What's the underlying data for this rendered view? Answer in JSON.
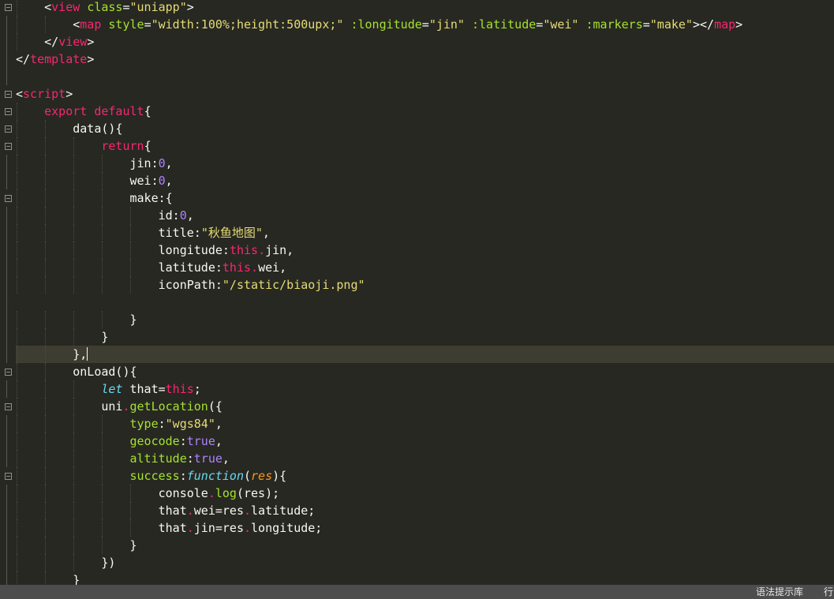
{
  "editor": {
    "lines": [
      {
        "indent": "    ",
        "tokens": [
          [
            "t-punc",
            "<"
          ],
          [
            "t-tag",
            "view"
          ],
          [
            "t-punc",
            " "
          ],
          [
            "t-attr",
            "class"
          ],
          [
            "t-punc",
            "="
          ],
          [
            "t-str",
            "\"uniapp\""
          ],
          [
            "t-punc",
            ">"
          ]
        ]
      },
      {
        "indent": "        ",
        "tokens": [
          [
            "t-punc",
            "<"
          ],
          [
            "t-tag",
            "map"
          ],
          [
            "t-punc",
            " "
          ],
          [
            "t-attr",
            "style"
          ],
          [
            "t-punc",
            "="
          ],
          [
            "t-str",
            "\"width:100%;height:500upx;\""
          ],
          [
            "t-punc",
            " "
          ],
          [
            "t-attr",
            ":longitude"
          ],
          [
            "t-punc",
            "="
          ],
          [
            "t-str",
            "\"jin\""
          ],
          [
            "t-punc",
            " "
          ],
          [
            "t-attr",
            ":latitude"
          ],
          [
            "t-punc",
            "="
          ],
          [
            "t-str",
            "\"wei\""
          ],
          [
            "t-punc",
            " "
          ],
          [
            "t-attr",
            ":markers"
          ],
          [
            "t-punc",
            "="
          ],
          [
            "t-str",
            "\"make\""
          ],
          [
            "t-punc",
            ">"
          ],
          [
            "t-punc",
            "</"
          ],
          [
            "t-tag",
            "map"
          ],
          [
            "t-punc",
            ">"
          ]
        ]
      },
      {
        "indent": "    ",
        "tokens": [
          [
            "t-punc",
            "</"
          ],
          [
            "t-tag",
            "view"
          ],
          [
            "t-punc",
            ">"
          ]
        ]
      },
      {
        "indent": "",
        "tokens": [
          [
            "t-punc",
            "</"
          ],
          [
            "t-tag",
            "template"
          ],
          [
            "t-punc",
            ">"
          ]
        ]
      },
      {
        "indent": "",
        "tokens": []
      },
      {
        "indent": "",
        "tokens": [
          [
            "t-punc",
            "<"
          ],
          [
            "t-tag",
            "script"
          ],
          [
            "t-punc",
            ">"
          ]
        ]
      },
      {
        "indent": "    ",
        "tokens": [
          [
            "t-kw",
            "export"
          ],
          [
            "t-punc",
            " "
          ],
          [
            "t-kw",
            "default"
          ],
          [
            "t-punc",
            "{"
          ]
        ]
      },
      {
        "indent": "        ",
        "tokens": [
          [
            "t-punc",
            "data(){"
          ]
        ]
      },
      {
        "indent": "            ",
        "tokens": [
          [
            "t-kw",
            "return"
          ],
          [
            "t-punc",
            "{"
          ]
        ]
      },
      {
        "indent": "                ",
        "tokens": [
          [
            "t-punc",
            "jin:"
          ],
          [
            "t-num",
            "0"
          ],
          [
            "t-punc",
            ","
          ]
        ]
      },
      {
        "indent": "                ",
        "tokens": [
          [
            "t-punc",
            "wei:"
          ],
          [
            "t-num",
            "0"
          ],
          [
            "t-punc",
            ","
          ]
        ]
      },
      {
        "indent": "                ",
        "tokens": [
          [
            "t-punc",
            "make:{"
          ]
        ]
      },
      {
        "indent": "                    ",
        "tokens": [
          [
            "t-punc",
            "id:"
          ],
          [
            "t-num",
            "0"
          ],
          [
            "t-punc",
            ","
          ]
        ]
      },
      {
        "indent": "                    ",
        "tokens": [
          [
            "t-punc",
            "title:"
          ],
          [
            "t-str",
            "\"秋鱼地图\""
          ],
          [
            "t-punc",
            ","
          ]
        ]
      },
      {
        "indent": "                    ",
        "tokens": [
          [
            "t-punc",
            "longitude:"
          ],
          [
            "t-kw",
            "this"
          ],
          [
            "t-dot",
            "."
          ],
          [
            "t-punc",
            "jin,"
          ]
        ]
      },
      {
        "indent": "                    ",
        "tokens": [
          [
            "t-punc",
            "latitude:"
          ],
          [
            "t-kw",
            "this"
          ],
          [
            "t-dot",
            "."
          ],
          [
            "t-punc",
            "wei,"
          ]
        ]
      },
      {
        "indent": "                    ",
        "tokens": [
          [
            "t-punc",
            "iconPath:"
          ],
          [
            "t-str",
            "\"/static/biaoji.png\""
          ]
        ]
      },
      {
        "indent": "",
        "tokens": []
      },
      {
        "indent": "                ",
        "tokens": [
          [
            "t-punc",
            "}"
          ]
        ]
      },
      {
        "indent": "            ",
        "tokens": [
          [
            "t-punc",
            "}"
          ]
        ]
      },
      {
        "indent": "        ",
        "tokens": [
          [
            "t-punc",
            "},"
          ]
        ]
      },
      {
        "indent": "        ",
        "tokens": [
          [
            "t-punc",
            "onLoad(){"
          ]
        ]
      },
      {
        "indent": "            ",
        "tokens": [
          [
            "t-ital",
            "let"
          ],
          [
            "t-punc",
            " that="
          ],
          [
            "t-kw",
            "this"
          ],
          [
            "t-punc",
            ";"
          ]
        ]
      },
      {
        "indent": "            ",
        "tokens": [
          [
            "t-punc",
            "uni"
          ],
          [
            "t-dot",
            "."
          ],
          [
            "t-fn",
            "getLocation"
          ],
          [
            "t-punc",
            "({"
          ]
        ]
      },
      {
        "indent": "                ",
        "tokens": [
          [
            "t-fn",
            "type"
          ],
          [
            "t-punc",
            ":"
          ],
          [
            "t-str",
            "\"wgs84\""
          ],
          [
            "t-punc",
            ","
          ]
        ]
      },
      {
        "indent": "                ",
        "tokens": [
          [
            "t-fn",
            "geocode"
          ],
          [
            "t-punc",
            ":"
          ],
          [
            "t-num",
            "true"
          ],
          [
            "t-punc",
            ","
          ]
        ]
      },
      {
        "indent": "                ",
        "tokens": [
          [
            "t-fn",
            "altitude"
          ],
          [
            "t-punc",
            ":"
          ],
          [
            "t-num",
            "true"
          ],
          [
            "t-punc",
            ","
          ]
        ]
      },
      {
        "indent": "                ",
        "tokens": [
          [
            "t-fn",
            "success"
          ],
          [
            "t-punc",
            ":"
          ],
          [
            "t-ital",
            "function"
          ],
          [
            "t-punc",
            "("
          ],
          [
            "t-param",
            "res"
          ],
          [
            "t-punc",
            "){"
          ]
        ]
      },
      {
        "indent": "                    ",
        "tokens": [
          [
            "t-punc",
            "console"
          ],
          [
            "t-dot",
            "."
          ],
          [
            "t-fn",
            "log"
          ],
          [
            "t-punc",
            "(res);"
          ]
        ]
      },
      {
        "indent": "                    ",
        "tokens": [
          [
            "t-punc",
            "that"
          ],
          [
            "t-dot",
            "."
          ],
          [
            "t-punc",
            "wei=res"
          ],
          [
            "t-dot",
            "."
          ],
          [
            "t-punc",
            "latitude;"
          ]
        ]
      },
      {
        "indent": "                    ",
        "tokens": [
          [
            "t-punc",
            "that"
          ],
          [
            "t-dot",
            "."
          ],
          [
            "t-punc",
            "jin=res"
          ],
          [
            "t-dot",
            "."
          ],
          [
            "t-punc",
            "longitude;"
          ]
        ]
      },
      {
        "indent": "                ",
        "tokens": [
          [
            "t-punc",
            "}"
          ]
        ]
      },
      {
        "indent": "            ",
        "tokens": [
          [
            "t-punc",
            "})"
          ]
        ]
      },
      {
        "indent": "        ",
        "tokens": [
          [
            "t-punc",
            "}"
          ]
        ]
      }
    ],
    "current_line": 20,
    "fold_markers": [
      0,
      5,
      6,
      7,
      8,
      11,
      21,
      23,
      27
    ]
  },
  "colors": {
    "background": "#272822",
    "current_line": "#3e3d32",
    "status_bar": "#4d4d4d"
  },
  "status_bar": {
    "hint_label": "语法提示库",
    "position_label": "行"
  }
}
